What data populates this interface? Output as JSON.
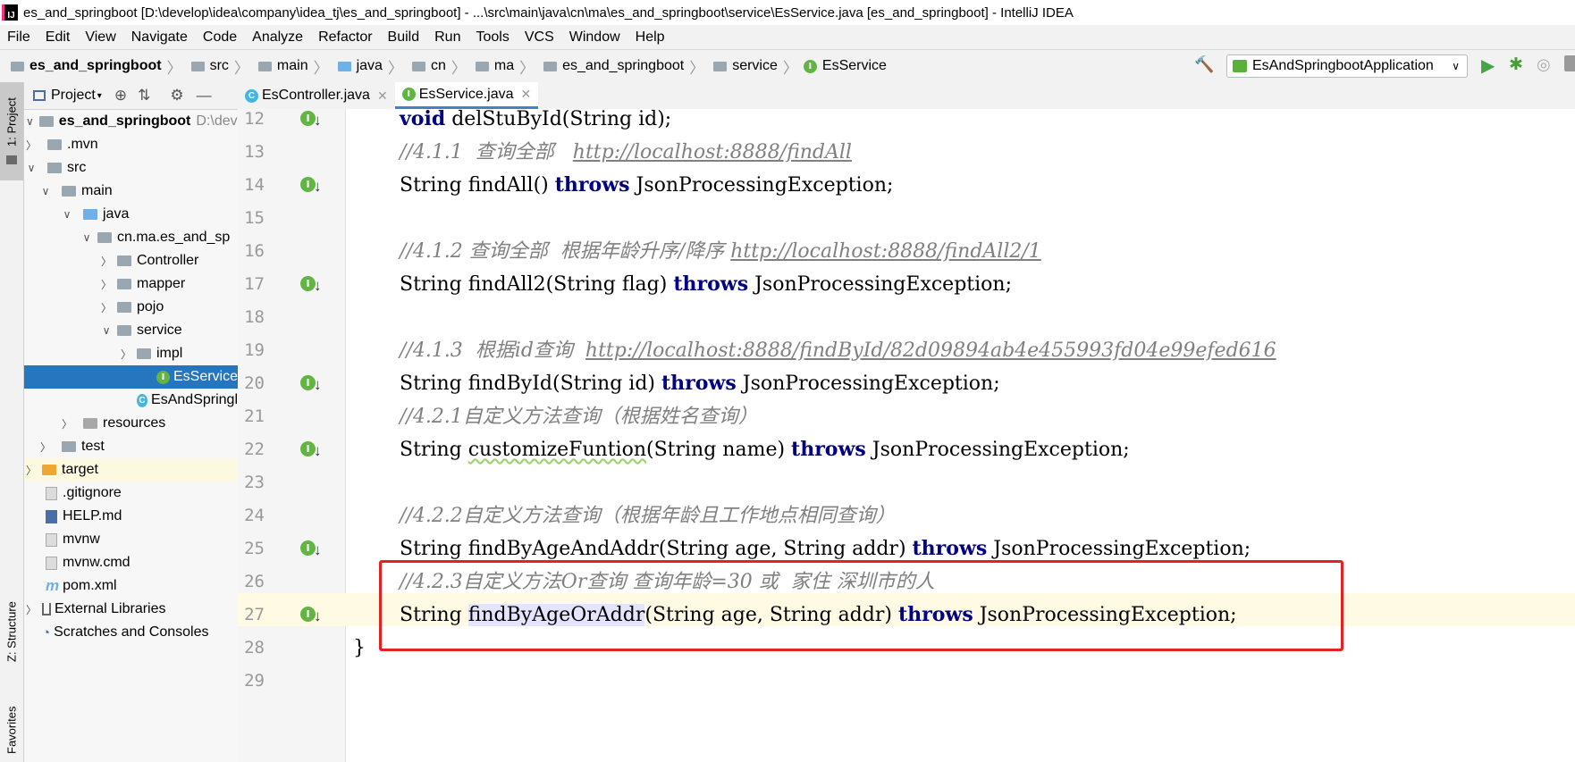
{
  "window": {
    "title": "es_and_springboot [D:\\develop\\idea\\company\\idea_tj\\es_and_springboot] - ...\\src\\main\\java\\cn\\ma\\es_and_springboot\\service\\EsService.java [es_and_springboot] - IntelliJ IDEA"
  },
  "menu": [
    "File",
    "Edit",
    "View",
    "Navigate",
    "Code",
    "Analyze",
    "Refactor",
    "Build",
    "Run",
    "Tools",
    "VCS",
    "Window",
    "Help"
  ],
  "breadcrumbs": [
    "es_and_springboot",
    "src",
    "main",
    "java",
    "cn",
    "ma",
    "es_and_springboot",
    "service",
    "EsService"
  ],
  "run_config": "EsAndSpringbootApplication",
  "side_tabs": {
    "project": "1: Project",
    "structure": "Z: Structure",
    "favorites": "Favorites"
  },
  "project_panel": {
    "title": "Project",
    "root_name": "es_and_springboot",
    "root_path": "D:\\develo",
    "items": [
      {
        "label": ".mvn"
      },
      {
        "label": "src"
      },
      {
        "label": "main"
      },
      {
        "label": "java"
      },
      {
        "label": "cn.ma.es_and_sp"
      },
      {
        "label": "Controller"
      },
      {
        "label": "mapper"
      },
      {
        "label": "pojo"
      },
      {
        "label": "service"
      },
      {
        "label": "impl"
      },
      {
        "label": "EsService"
      },
      {
        "label": "EsAndSpringl"
      },
      {
        "label": "resources"
      },
      {
        "label": "test"
      },
      {
        "label": "target"
      },
      {
        "label": ".gitignore"
      },
      {
        "label": "HELP.md"
      },
      {
        "label": "mvnw"
      },
      {
        "label": "mvnw.cmd"
      },
      {
        "label": "pom.xml"
      },
      {
        "label": "External Libraries"
      },
      {
        "label": "Scratches and Consoles"
      }
    ]
  },
  "tabs": [
    {
      "label": "EsController.java"
    },
    {
      "label": "EsService.java"
    }
  ],
  "editor": {
    "line_numbers": [
      "12",
      "13",
      "14",
      "15",
      "16",
      "17",
      "18",
      "19",
      "20",
      "21",
      "22",
      "23",
      "24",
      "25",
      "26",
      "27",
      "28",
      "29"
    ],
    "lines": {
      "l12": {
        "kw": "void",
        "rest": " delStuById(String id);"
      },
      "l13": {
        "comment": "//4.1.1  查询全部   ",
        "link": "http://localhost:8888/findAll"
      },
      "l14": {
        "a": "String findAll() ",
        "kw": "throws",
        "rest": " JsonProcessingException;"
      },
      "l16": {
        "comment": "//4.1.2 查询全部  根据年龄升序/降序 ",
        "link": "http://localhost:8888/findAll2/1"
      },
      "l17": {
        "a": "String findAll2(String flag) ",
        "kw": "throws",
        "rest": " JsonProcessingException;"
      },
      "l19": {
        "comment": "//4.1.3  根据id查询  ",
        "link": "http://localhost:8888/findById/82d09894ab4e455993fd04e99efed616"
      },
      "l20": {
        "a": "String findById(String id) ",
        "kw": "throws",
        "rest": " JsonProcessingException;"
      },
      "l21": {
        "comment": "//4.2.1自定义方法查询（根据姓名查询）"
      },
      "l22": {
        "a": "String ",
        "warn": "customizeFuntion",
        "b": "(String name) ",
        "kw": "throws",
        "rest": " JsonProcessingException;"
      },
      "l24": {
        "comment": "//4.2.2自定义方法查询（根据年龄且工作地点相同查询）"
      },
      "l25": {
        "a": "String findByAgeAndAddr(String age, String addr) ",
        "kw": "throws",
        "rest": " JsonProcessingException;"
      },
      "l26": {
        "comment": "//4.2.3自定义方法Or查询 查询年龄=30 或  家住 深圳市的人"
      },
      "l27": {
        "a": "String ",
        "sel": "findByAgeOrAddr",
        "b": "(String age, String addr) ",
        "kw": "throws",
        "rest": " JsonProcessingException;"
      },
      "l28": {
        "a": "}"
      }
    },
    "gutter_icon_label": "I"
  }
}
